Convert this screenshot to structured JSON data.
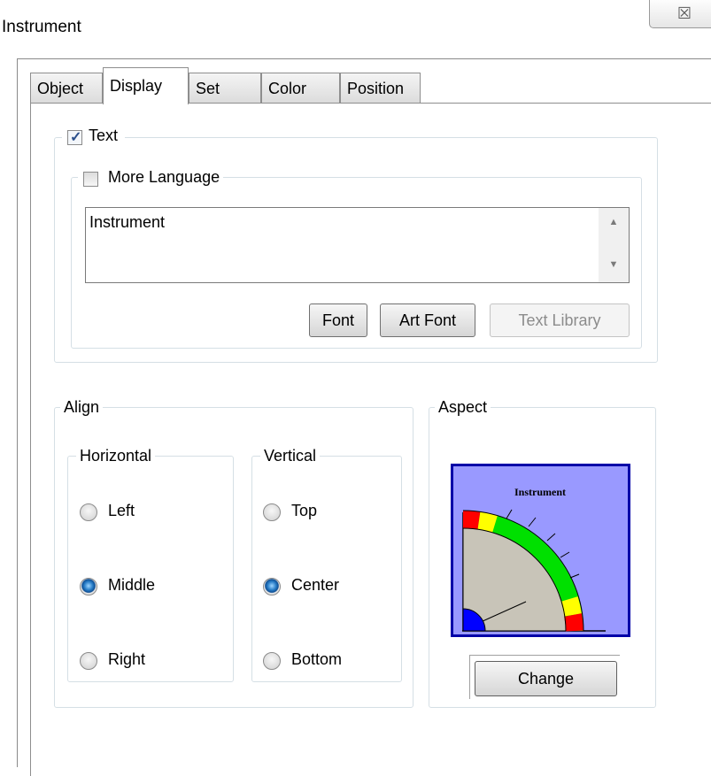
{
  "window": {
    "title": "Instrument",
    "close_glyph": "☒"
  },
  "tabs": [
    {
      "label": "Object",
      "active": false
    },
    {
      "label": "Display",
      "active": true
    },
    {
      "label": "Set",
      "active": false
    },
    {
      "label": "Color",
      "active": false
    },
    {
      "label": "Position",
      "active": false
    }
  ],
  "text_group": {
    "checkbox_label": "Text",
    "checked": true,
    "more_language": {
      "label": "More Language",
      "checked": false,
      "textarea_value": "Instrument"
    },
    "buttons": {
      "font": "Font",
      "art_font": "Art Font",
      "text_library": "Text Library"
    }
  },
  "align": {
    "title": "Align",
    "horizontal": {
      "title": "Horizontal",
      "options": [
        "Left",
        "Middle",
        "Right"
      ],
      "selected": "Middle"
    },
    "vertical": {
      "title": "Vertical",
      "options": [
        "Top",
        "Center",
        "Bottom"
      ],
      "selected": "Center"
    }
  },
  "aspect": {
    "title": "Aspect",
    "preview_title": "Instrument",
    "change_label": "Change",
    "colors": {
      "background": "#9999ff",
      "border": "#0000a8",
      "dial": "#c8c4b8",
      "red": "#ff0000",
      "yellow": "#ffff00",
      "green": "#00e000",
      "hub": "#0000ff"
    }
  },
  "icons": {
    "close": "close-icon",
    "scroll_up": "scroll-up-icon",
    "scroll_down": "scroll-down-icon",
    "check": "checkmark-icon"
  }
}
